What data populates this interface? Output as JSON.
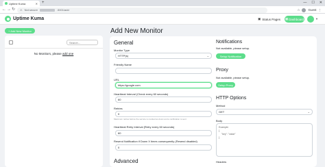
{
  "browser": {
    "tab_title": "Uptime Kuma",
    "new_tab": "+",
    "security_label": "Not secure",
    "url_suffix": ":3001/add",
    "profile_label": "Guest"
  },
  "header": {
    "app_title": "Uptime Kuma",
    "status_pages": "Status Pages",
    "dashboard": "Dashboard"
  },
  "sidebar": {
    "add_button": "+ Add New Monitor",
    "search_placeholder": "Search...",
    "empty_text": "No Monitors, please ",
    "empty_link": "add one"
  },
  "main": {
    "page_title": "Add New Monitor",
    "general": {
      "title": "General",
      "monitor_type_label": "Monitor Type",
      "monitor_type_value": "HTTP(s)",
      "friendly_name_label": "Friendly Name",
      "friendly_name_value": "",
      "url_label": "URL",
      "url_value": "https://google.com",
      "interval_label": "Heartbeat Interval (Check every 60 seconds)",
      "interval_value": "60",
      "retries_label": "Retries",
      "retries_value": "0",
      "retries_hint": "Maximum retries before the service is marked as down and a notification is sent",
      "retry_interval_label": "Heartbeat Retry Interval (Retry every 60 seconds)",
      "retry_interval_value": "60",
      "resend_label": "Resend Notification if Down X times consequently (Resend disabled)",
      "resend_value": "0"
    },
    "advanced": {
      "title": "Advanced"
    },
    "notifications": {
      "title": "Notifications",
      "empty": "Not available, please setup.",
      "setup_button": "Setup Notification"
    },
    "proxy": {
      "title": "Proxy",
      "empty": "Not available, please setup.",
      "setup_button": "Setup Proxy"
    },
    "http_options": {
      "title": "HTTP Options",
      "method_label": "Method",
      "method_value": "GET",
      "body_label": "Body",
      "body_placeholder": "Example:\n{\n    \"key\": \"value\"\n}",
      "headers_label": "Headers"
    }
  }
}
